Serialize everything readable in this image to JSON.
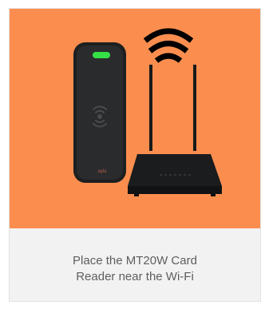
{
  "illustration": {
    "background_color": "#fb8e4f",
    "reader_brand": "ayla",
    "icons": [
      "card-reader-icon",
      "wifi-signal-icon",
      "wifi-router-icon"
    ]
  },
  "caption": {
    "line1": "Place the MT20W Card",
    "line2": "Reader near the Wi-Fi"
  }
}
